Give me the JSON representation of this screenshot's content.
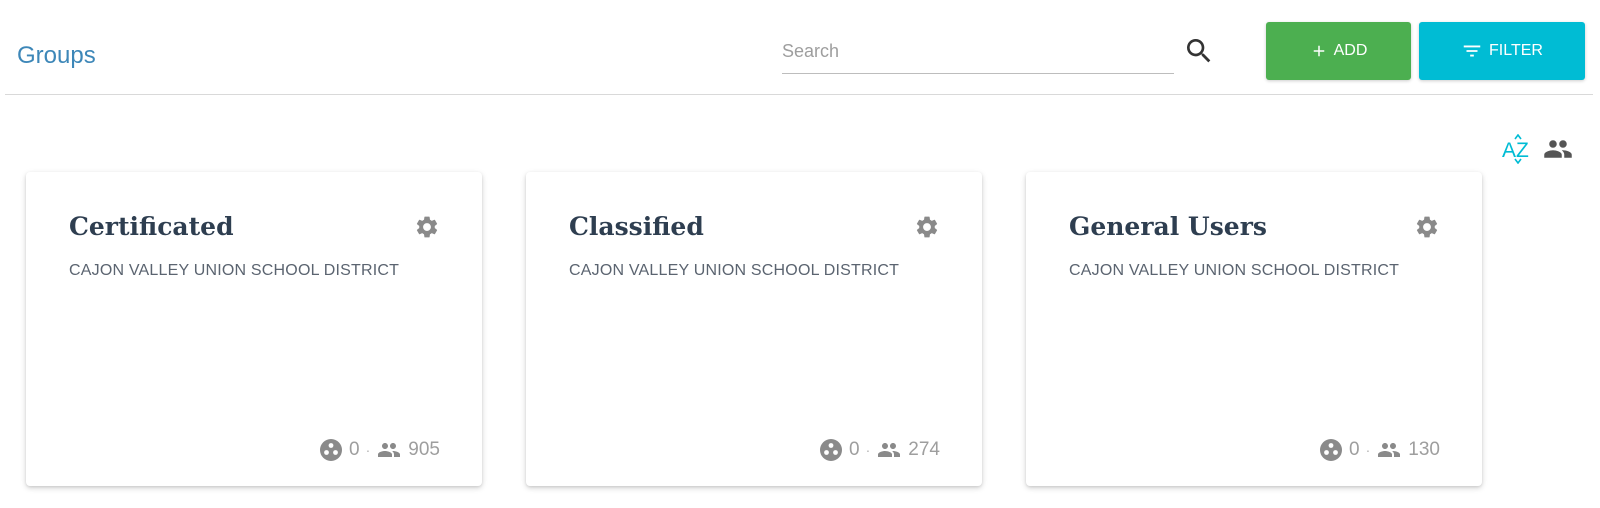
{
  "header": {
    "title": "Groups",
    "search": {
      "placeholder": "Search",
      "value": ""
    },
    "add_label": "ADD",
    "filter_label": "FILTER"
  },
  "sort": {
    "az_icon": "sort-alpha-icon",
    "members_icon": "people-icon"
  },
  "colors": {
    "add": "#4caf50",
    "filter": "#00bcd4",
    "title": "#3d87b8",
    "az": "#00bcd4"
  },
  "groups": [
    {
      "name": "Certificated",
      "org": "CAJON VALLEY UNION SCHOOL DISTRICT",
      "subgroups": "0",
      "members": "905"
    },
    {
      "name": "Classified",
      "org": "CAJON VALLEY UNION SCHOOL DISTRICT",
      "subgroups": "0",
      "members": "274"
    },
    {
      "name": "General Users",
      "org": "CAJON VALLEY UNION SCHOOL DISTRICT",
      "subgroups": "0",
      "members": "130"
    }
  ]
}
